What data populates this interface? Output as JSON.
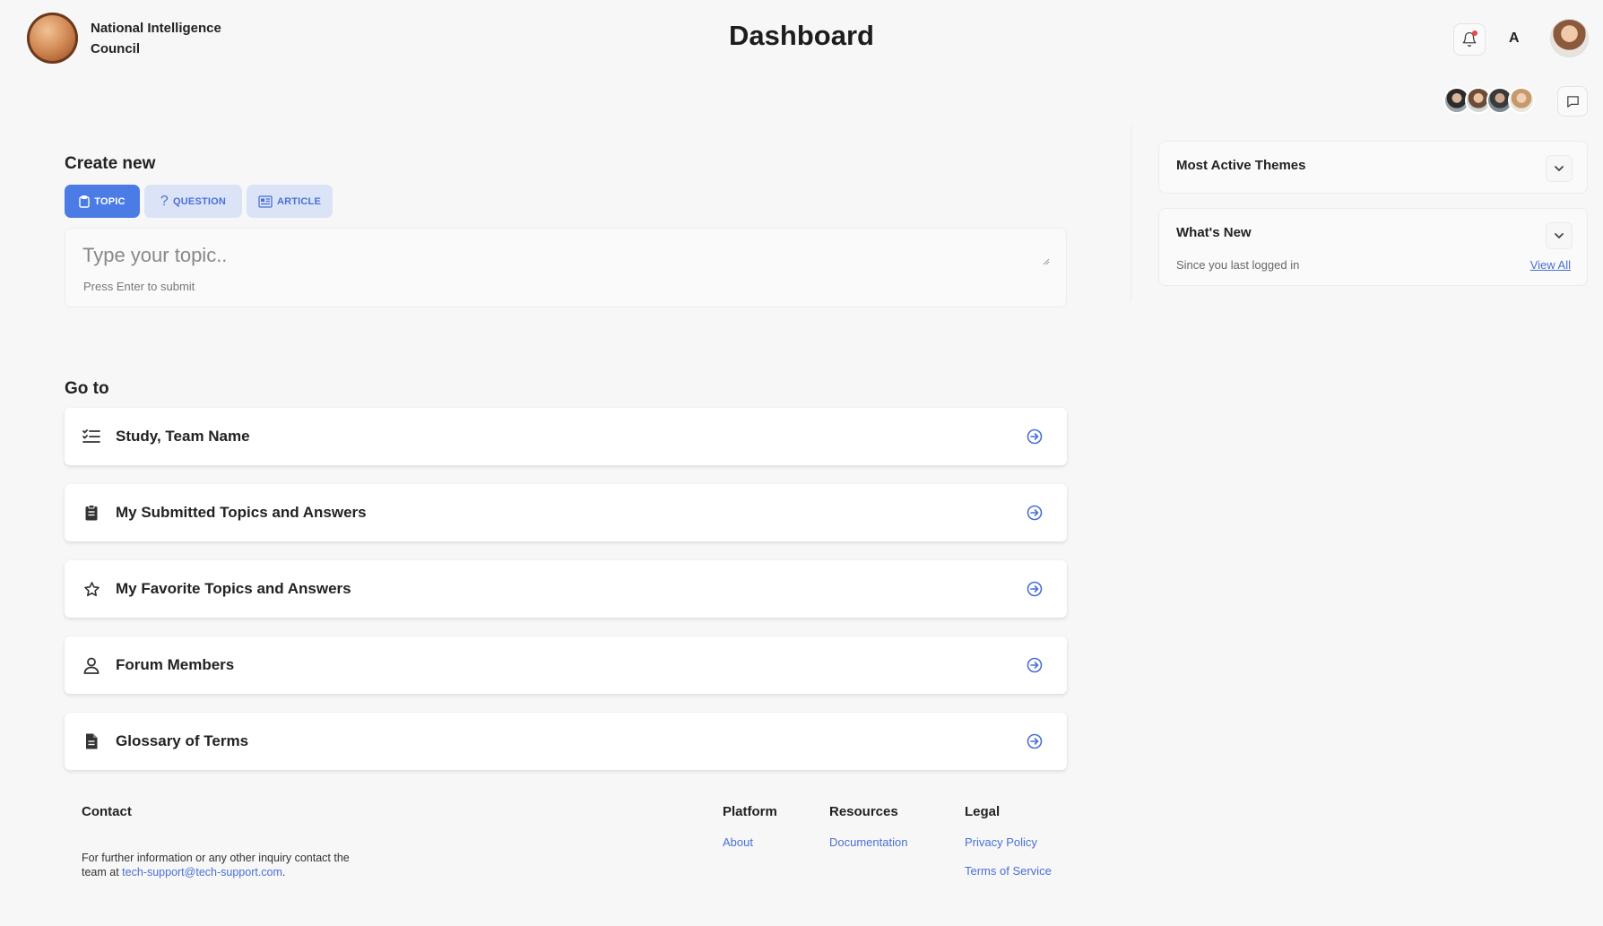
{
  "header": {
    "org_name": "National Intelligence Council",
    "title": "Dashboard",
    "language": "A",
    "icons": {
      "notifications": "bell-icon",
      "messages": "chat-bubble-icon"
    }
  },
  "create": {
    "title": "Create new",
    "tabs": [
      {
        "label": "TOPIC",
        "icon": "clipboard-icon",
        "active": true
      },
      {
        "label": "QUESTION",
        "icon": "question-mark-icon",
        "active": false
      },
      {
        "label": "ARTICLE",
        "icon": "newspaper-icon",
        "active": false
      }
    ],
    "placeholder": "Type your topic..",
    "hint": "Press Enter to submit"
  },
  "goto": {
    "title": "Go to",
    "items": [
      {
        "label": "Study, Team Name",
        "icon": "checklist-icon"
      },
      {
        "label": "My Submitted Topics and Answers",
        "icon": "clipboard-filled-icon"
      },
      {
        "label": "My Favorite Topics and Answers",
        "icon": "star-icon"
      },
      {
        "label": "Forum Members",
        "icon": "user-icon"
      },
      {
        "label": "Glossary of Terms",
        "icon": "document-icon"
      }
    ]
  },
  "panels": {
    "most_active": {
      "title": "Most Active Themes"
    },
    "whats_new": {
      "title": "What's New",
      "subtitle": "Since you last logged in",
      "link": "View All"
    }
  },
  "footer": {
    "contact_title": "Contact",
    "contact_text": "For further information or any other inquiry contact the team at ",
    "contact_email": "tech-support@tech-support.com",
    "contact_end": ".",
    "platform_title": "Platform",
    "platform_links": [
      "About"
    ],
    "resources_title": "Resources",
    "resources_links": [
      "Documentation"
    ],
    "legal_title": "Legal",
    "legal_links": [
      "Privacy Policy",
      "Terms of Service"
    ]
  },
  "colors": {
    "accent": "#4b7be5",
    "accent_light": "#dbe4f7",
    "link": "#4a6fd6",
    "background": "#f7f7f7"
  }
}
